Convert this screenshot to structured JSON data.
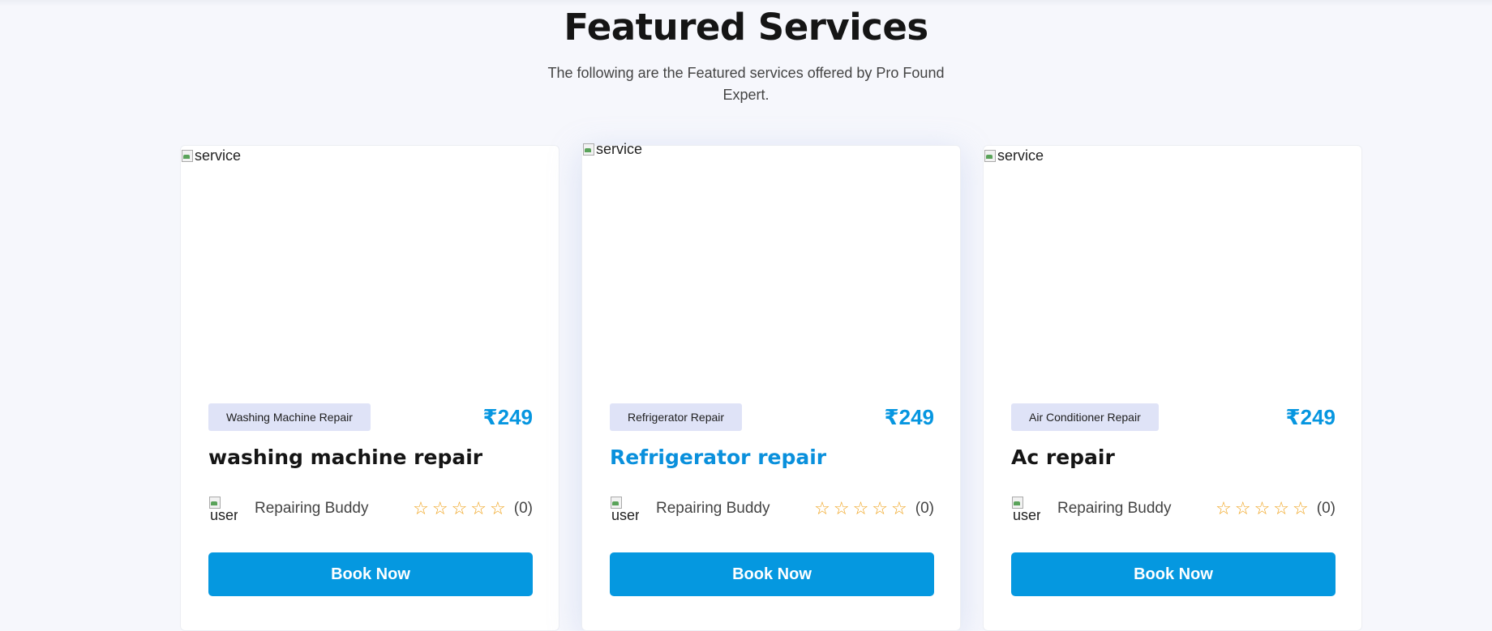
{
  "section": {
    "title": "Featured Services",
    "subtitle": "The following are the Featured services offered by Pro Found Expert."
  },
  "cards": [
    {
      "image_alt": "service",
      "category": "Washing Machine Repair",
      "price": "₹249",
      "name": "washing machine repair",
      "avatar_alt": "user",
      "provider": "Repairing Buddy",
      "rating": 0,
      "review_count": "(0)",
      "button_label": "Book Now"
    },
    {
      "image_alt": "service",
      "category": "Refrigerator Repair",
      "price": "₹249",
      "name": "Refrigerator repair",
      "avatar_alt": "user",
      "provider": "Repairing Buddy",
      "rating": 0,
      "review_count": "(0)",
      "button_label": "Book Now"
    },
    {
      "image_alt": "service",
      "category": "Air Conditioner Repair",
      "price": "₹249",
      "name": "Ac repair",
      "avatar_alt": "user",
      "provider": "Repairing Buddy",
      "rating": 0,
      "review_count": "(0)",
      "button_label": "Book Now"
    }
  ],
  "colors": {
    "accent": "#0598e0",
    "star": "#f0a31c",
    "badge_bg": "#dfe3f7",
    "background": "#f6f7fc"
  },
  "icons": {
    "star": "star-outline-icon",
    "broken_image": "broken-image-icon"
  }
}
